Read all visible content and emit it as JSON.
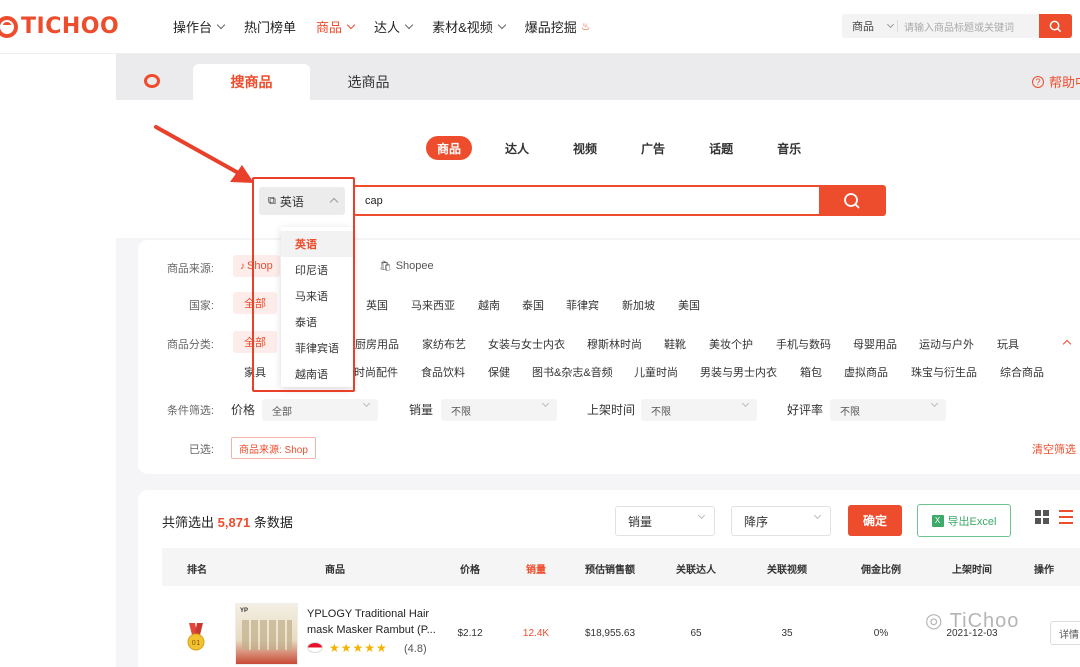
{
  "brand": {
    "logo_text": "TICHOO",
    "accent": "#ee4d2d"
  },
  "nav": {
    "items": [
      {
        "label": "操作台",
        "dropdown": true
      },
      {
        "label": "热门榜单",
        "dropdown": false
      },
      {
        "label": "商品",
        "dropdown": true,
        "active": true
      },
      {
        "label": "达人",
        "dropdown": true
      },
      {
        "label": "素材&视频",
        "dropdown": true
      },
      {
        "label": "爆品挖掘",
        "dropdown": false,
        "icon": "flame-icon"
      }
    ],
    "search": {
      "type_label": "商品",
      "placeholder": "请输入商品标题或关键词"
    }
  },
  "tabs": {
    "active": "搜商品",
    "inactive": "选商品",
    "help": "帮助中"
  },
  "search": {
    "type_tabs": [
      "商品",
      "达人",
      "视频",
      "广告",
      "话题",
      "音乐"
    ],
    "language": "英语",
    "query": "cap",
    "language_options": [
      "英语",
      "印尼语",
      "马来语",
      "泰语",
      "菲律宾语",
      "越南语"
    ]
  },
  "filters": {
    "source_label": "商品来源:",
    "source_tiktok": "Shop",
    "source_shopee": "Shopee",
    "country_label": "国家:",
    "countries": [
      "全部",
      "英国",
      "马来西亚",
      "越南",
      "泰国",
      "菲律宾",
      "新加坡",
      "美国"
    ],
    "category_label": "商品分类:",
    "categories_row1": [
      "全部",
      "厨房用品",
      "家纺布艺",
      "女装与女士内衣",
      "穆斯林时尚",
      "鞋靴",
      "美妆个护",
      "手机与数码",
      "母婴用品",
      "运动与户外",
      "玩具"
    ],
    "categories_row2": [
      "家具",
      "时尚配件",
      "食品饮料",
      "保健",
      "图书&杂志&音频",
      "儿童时尚",
      "男装与男士内衣",
      "箱包",
      "虚拟商品",
      "珠宝与衍生品",
      "综合商品"
    ],
    "condition_label": "条件筛选:",
    "conditions": [
      {
        "name": "价格",
        "value": "全部"
      },
      {
        "name": "销量",
        "value": "不限"
      },
      {
        "name": "上架时间",
        "value": "不限"
      },
      {
        "name": "好评率",
        "value": "不限"
      }
    ],
    "selected_label": "已选:",
    "selected_tag": "商品来源:  Shop",
    "clear": "清空筛选"
  },
  "results": {
    "count_prefix": "共筛选出",
    "count": "5,871",
    "count_suffix": "条数据",
    "sort_field": "销量",
    "sort_order": "降序",
    "confirm": "确定",
    "export": "导出Excel",
    "columns": [
      "排名",
      "商品",
      "价格",
      "销量",
      "预估销售额",
      "关联达人",
      "关联视频",
      "佣金比例",
      "上架时间",
      "操作"
    ],
    "rows": [
      {
        "rank": "01",
        "thumb_label": "YP",
        "name": "YPLOGY Traditional Hair mask Masker Rambut (P...",
        "stars": "★★★★★",
        "rating": "(4.8)",
        "price": "$2.12",
        "sales": "12.4K",
        "revenue": "$18,955.63",
        "influencers": "65",
        "videos": "35",
        "commission": "0%",
        "listed": "2021-12-03",
        "action": "详情"
      }
    ]
  },
  "watermark": "TiChoo"
}
